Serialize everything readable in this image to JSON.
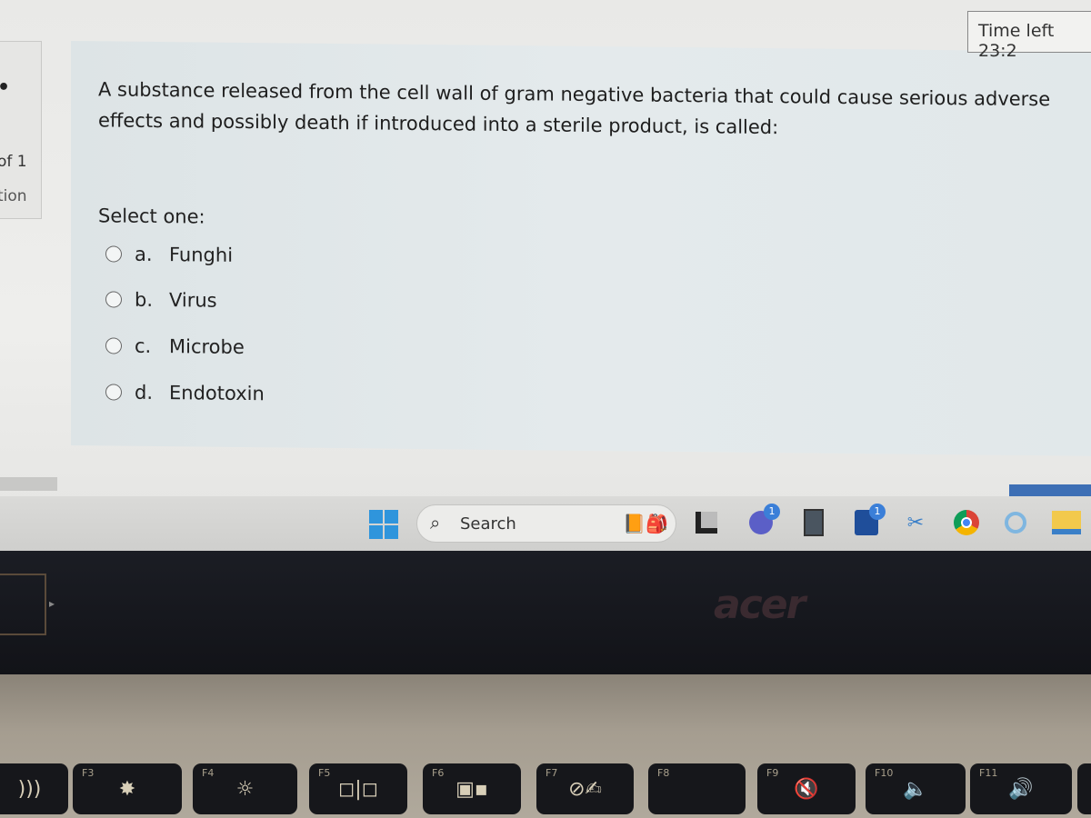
{
  "sidebar": {
    "page_of": "of 1",
    "nav_label": "tion"
  },
  "timer": {
    "label": "Time left 23:2"
  },
  "question": {
    "text": "A substance released from the cell wall of gram negative bacteria that could cause serious adverse effects and possibly death if introduced into a sterile product, is called:",
    "select_label": "Select one:",
    "options": [
      {
        "letter": "a.",
        "label": "Funghi",
        "selected": false
      },
      {
        "letter": "b.",
        "label": "Virus",
        "selected": false
      },
      {
        "letter": "c.",
        "label": "Microbe",
        "selected": false
      },
      {
        "letter": "d.",
        "label": "Endotoxin",
        "selected": false
      }
    ]
  },
  "taskbar": {
    "search_label": "Search",
    "apps": [
      {
        "icon": "task-view-icon"
      },
      {
        "icon": "teams-chat-icon",
        "badge": "1"
      },
      {
        "icon": "calculator-icon"
      },
      {
        "icon": "microsoft-store-icon",
        "badge": "1"
      },
      {
        "icon": "snipping-tool-icon"
      },
      {
        "icon": "chrome-icon"
      },
      {
        "icon": "cortana-icon"
      },
      {
        "icon": "file-explorer-icon"
      }
    ]
  },
  "laptop": {
    "brand": "acer",
    "keys": [
      "F3",
      "F4",
      "F5",
      "F6",
      "F7",
      "F8",
      "F9",
      "F10",
      "F11"
    ]
  }
}
